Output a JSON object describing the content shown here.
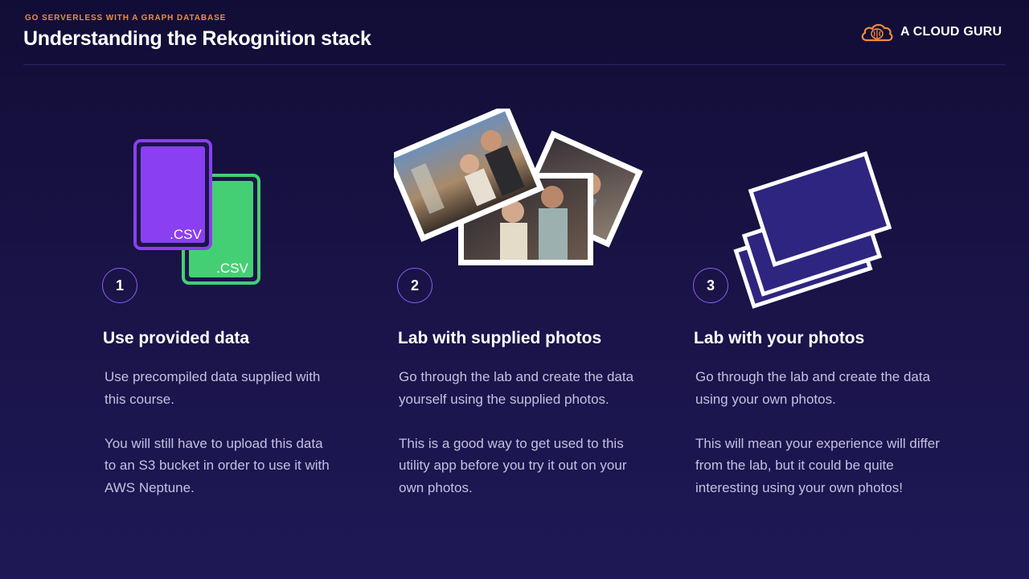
{
  "header": {
    "kicker": "GO SERVERLESS WITH A GRAPH DATABASE",
    "title": "Understanding the Rekognition stack",
    "logo_text": "A CLOUD GURU",
    "logo_icon": "cloud-brain-icon",
    "brand_color": "#f08a3c"
  },
  "columns": [
    {
      "number": "1",
      "heading": "Use provided data",
      "paragraphs": [
        "Use precompiled data supplied with this course.",
        "You will still have to upload this data to an S3 bucket in order to use it with AWS Neptune."
      ],
      "illustration": {
        "icon": "csv-files-icon",
        "file_label_1": ".CSV",
        "file_label_2": ".CSV",
        "color_1": "#8a3ff0",
        "color_2": "#45cf74"
      }
    },
    {
      "number": "2",
      "heading": "Lab with supplied photos",
      "paragraphs": [
        "Go through the lab and create the data yourself using the supplied photos.",
        "This is a good way to get used to this utility app before you try it out on your own photos."
      ],
      "illustration": {
        "icon": "photo-stack-icon"
      }
    },
    {
      "number": "3",
      "heading": "Lab with your photos",
      "paragraphs": [
        "Go through the lab and create the data using your own photos.",
        "This will mean your experience will differ from the lab, but it could be quite interesting using your own photos!"
      ],
      "illustration": {
        "icon": "blank-photos-icon",
        "color": "#2e2580"
      }
    }
  ]
}
